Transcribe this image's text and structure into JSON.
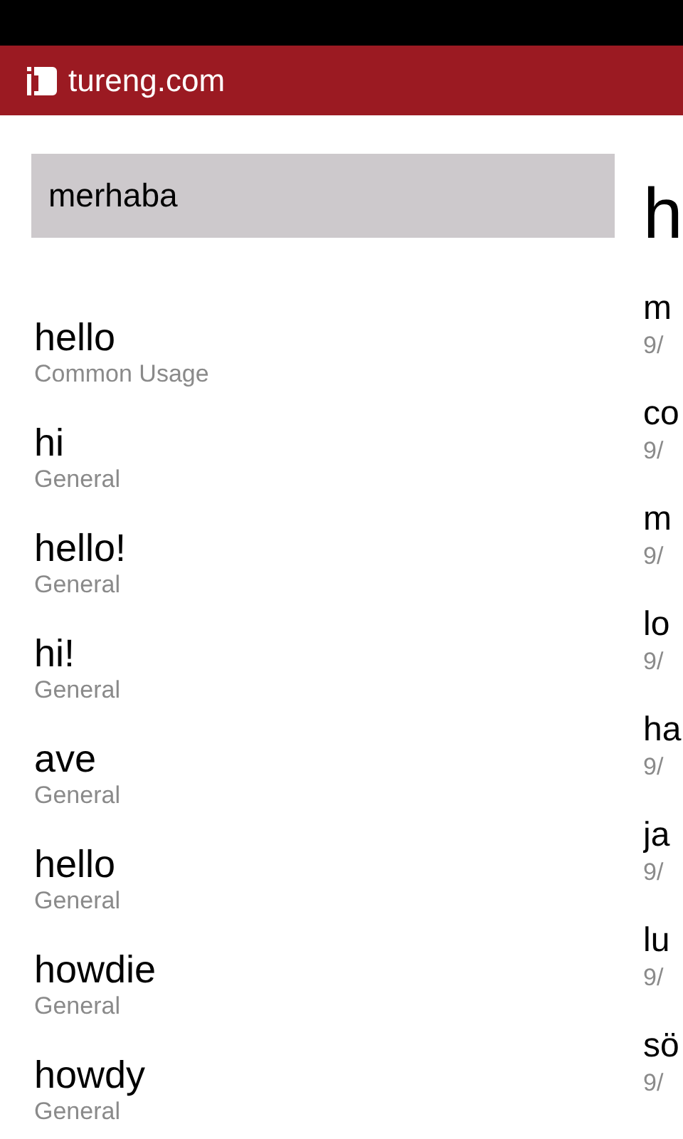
{
  "header": {
    "title": "tureng.com"
  },
  "search": {
    "value": "merhaba"
  },
  "results": [
    {
      "term": "hello",
      "category": "Common Usage"
    },
    {
      "term": "hi",
      "category": "General"
    },
    {
      "term": "hello!",
      "category": "General"
    },
    {
      "term": "hi!",
      "category": "General"
    },
    {
      "term": "ave",
      "category": "General"
    },
    {
      "term": "hello",
      "category": "General"
    },
    {
      "term": "howdie",
      "category": "General"
    },
    {
      "term": "howdy",
      "category": "General"
    }
  ],
  "history": {
    "title": "h",
    "items": [
      {
        "term": "m",
        "date": "9/"
      },
      {
        "term": "co",
        "date": "9/"
      },
      {
        "term": "m",
        "date": "9/"
      },
      {
        "term": "lo",
        "date": "9/"
      },
      {
        "term": "ha",
        "date": "9/"
      },
      {
        "term": "ja",
        "date": "9/"
      },
      {
        "term": "lu",
        "date": "9/"
      },
      {
        "term": "sö",
        "date": "9/"
      }
    ]
  }
}
